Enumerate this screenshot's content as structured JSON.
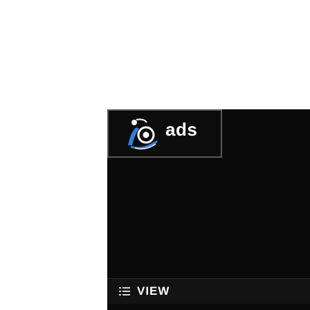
{
  "brand": {
    "logo_icon": "person-at-sign-icon",
    "name": "ads"
  },
  "view_bar": {
    "icon": "list-icon",
    "label": "VIEW"
  },
  "colors": {
    "panel_background": "#0a0a0a",
    "brand_border": "#5a5a5a",
    "accent_blue": "#2f7fe0",
    "text": "#ffffff"
  }
}
